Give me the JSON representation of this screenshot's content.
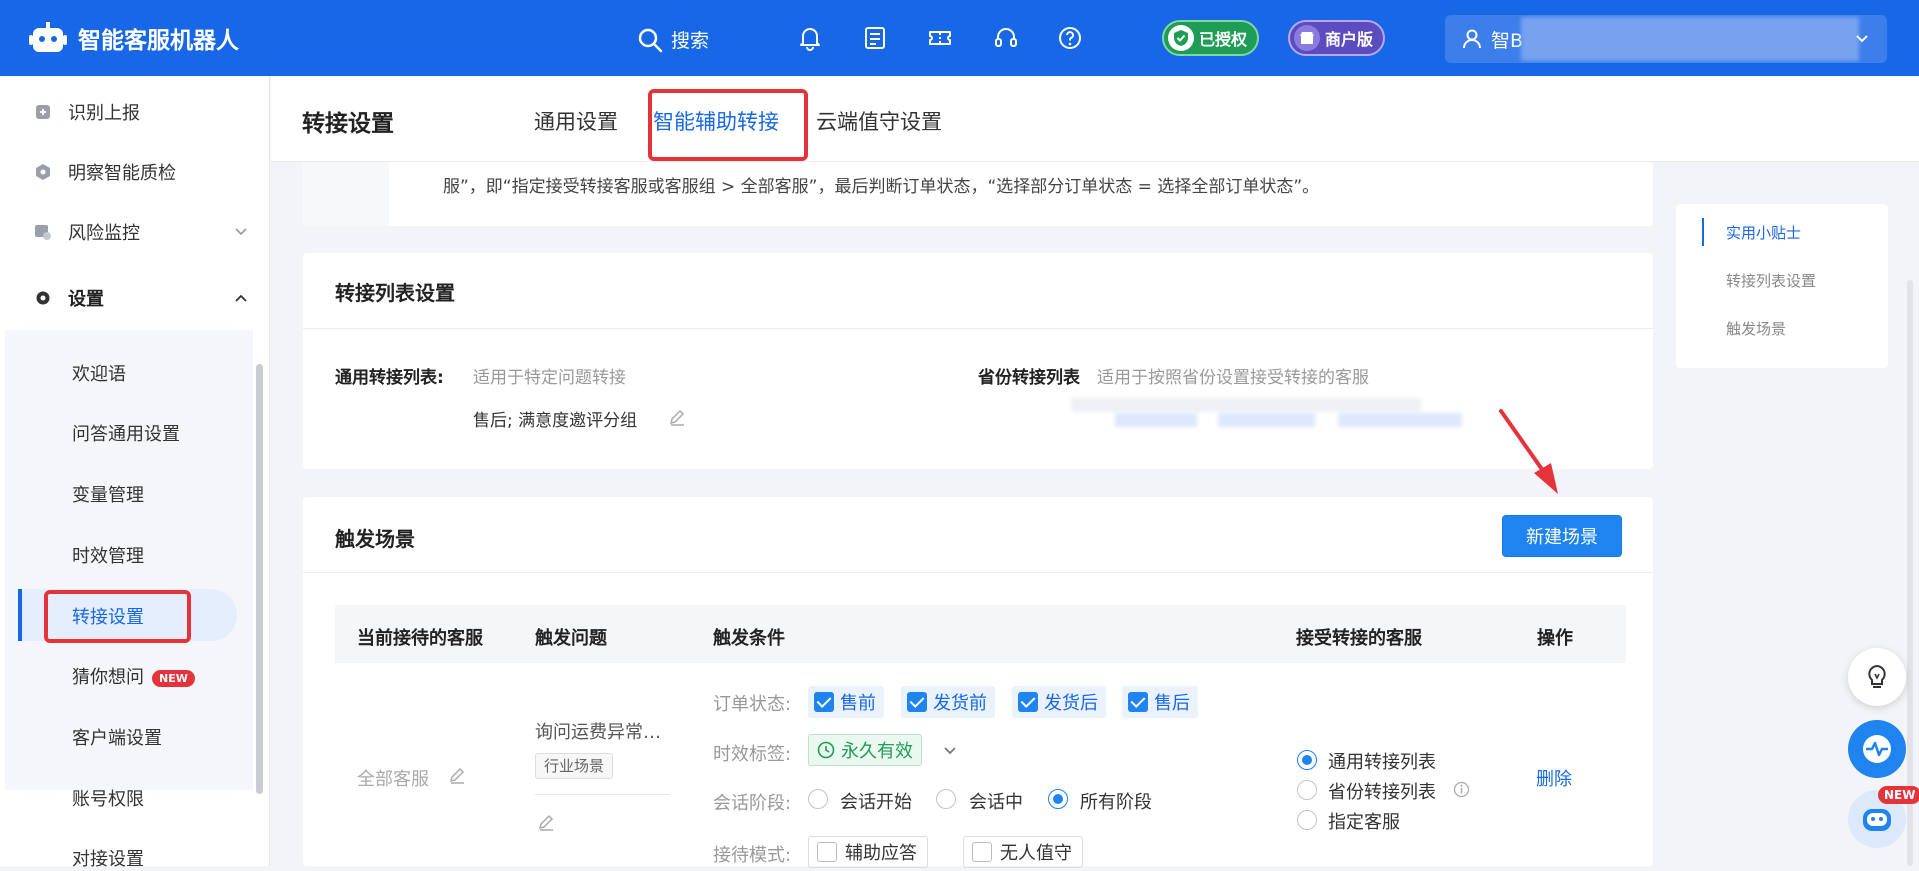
{
  "app": {
    "title": "智能客服机器人",
    "search_label": "搜索",
    "auth_badge": "已授权",
    "merchant_badge": "商户版",
    "user_name": "智B"
  },
  "sidebar": {
    "items": [
      {
        "label": "识别上报"
      },
      {
        "label": "明察智能质检"
      },
      {
        "label": "风险监控"
      },
      {
        "label": "设置"
      }
    ],
    "sub_items": [
      {
        "label": "欢迎语"
      },
      {
        "label": "问答通用设置"
      },
      {
        "label": "变量管理"
      },
      {
        "label": "时效管理"
      },
      {
        "label": "转接设置"
      },
      {
        "label": "猜你想问",
        "tag": "NEW"
      },
      {
        "label": "客户端设置"
      },
      {
        "label": "账号权限"
      },
      {
        "label": "对接设置"
      }
    ]
  },
  "header": {
    "title": "转接设置",
    "tabs": [
      {
        "label": "通用设置"
      },
      {
        "label": "智能辅助转接"
      },
      {
        "label": "云端值守设置"
      }
    ]
  },
  "tip_card": {
    "text": "服”，即“指定接受转接客服或客服组 > 全部客服”，最后判断订单状态，“选择部分订单状态 = 选择全部订单状态”。"
  },
  "list_settings": {
    "title": "转接列表设置",
    "general_label": "通用转接列表:",
    "general_desc": "适用于特定问题转接",
    "general_value": "售后; 满意度邀评分组",
    "province_label": "省份转接列表",
    "province_desc": "适用于按照省份设置接受转接的客服"
  },
  "trigger": {
    "title": "触发场景",
    "new_button": "新建场景",
    "columns": [
      "当前接待的客服",
      "触发问题",
      "触发条件",
      "接受转接的客服",
      "操作"
    ],
    "row": {
      "agent": "全部客服",
      "question": "询问运费异常…",
      "question_tag": "行业场景",
      "order_status_label": "订单状态:",
      "order_status": [
        "售前",
        "发货前",
        "发货后",
        "售后"
      ],
      "time_tag_label": "时效标签:",
      "time_tag_value": "永久有效",
      "stage_label": "会话阶段:",
      "stages": [
        {
          "label": "会话开始",
          "selected": false
        },
        {
          "label": "会话中",
          "selected": false
        },
        {
          "label": "所有阶段",
          "selected": true
        }
      ],
      "mode_label": "接待模式:",
      "modes": [
        "辅助应答",
        "无人值守"
      ],
      "targets": [
        {
          "label": "通用转接列表",
          "selected": true
        },
        {
          "label": "省份转接列表",
          "selected": false
        },
        {
          "label": "指定客服",
          "selected": false
        }
      ],
      "action": "删除"
    }
  },
  "anchor_nav": {
    "items": [
      {
        "label": "实用小贴士"
      },
      {
        "label": "转接列表设置"
      },
      {
        "label": "触发场景"
      }
    ]
  },
  "float_new_tag": "NEW",
  "colors": {
    "primary": "#1867e6",
    "highlight": "#e5333b",
    "success": "#1f9c55"
  }
}
